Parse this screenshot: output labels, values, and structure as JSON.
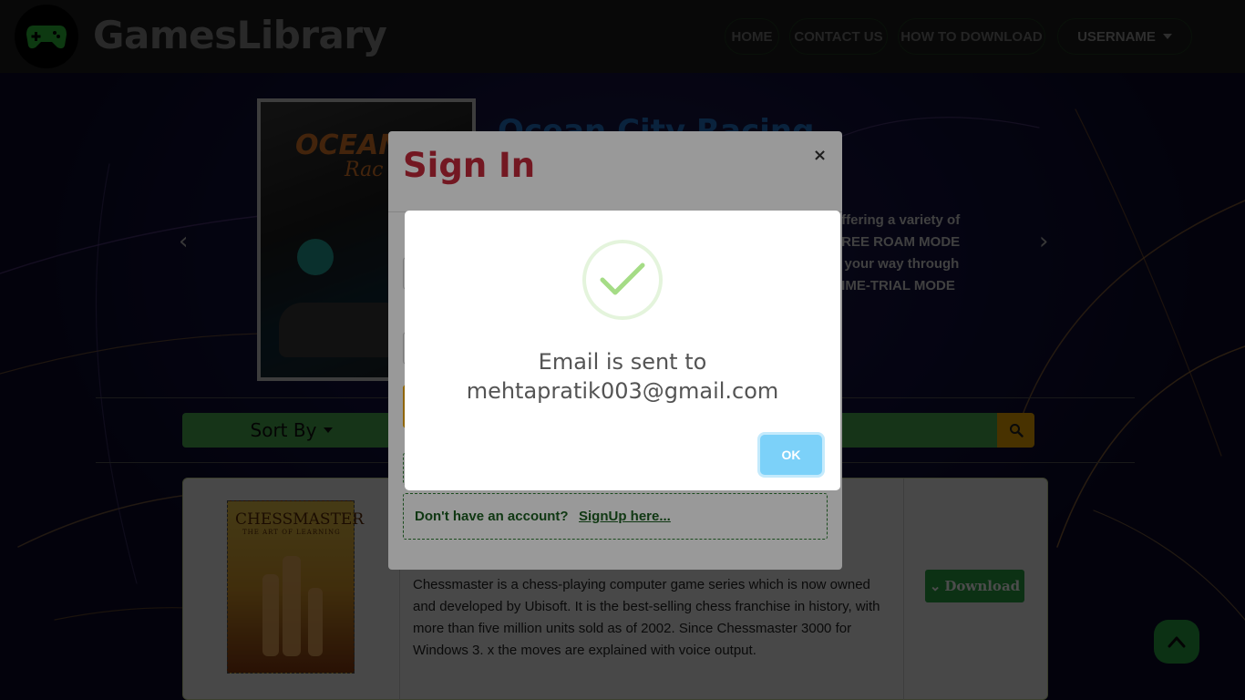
{
  "nav": {
    "brand": "GamesLibrary",
    "items": [
      "HOME",
      "CONTACT US",
      "HOW TO DOWNLOAD"
    ],
    "user": "USERNAME"
  },
  "carousel": {
    "game_title": "Ocean City Racing",
    "cover_title": "OCEAN",
    "cover_sub": "Rac",
    "desc_lines": [
      "offering a variety of",
      "FREE ROAM MODE",
      "e your way through",
      "TIME-TRIAL MODE"
    ]
  },
  "controls": {
    "sort_label": "Sort By"
  },
  "card": {
    "cover_title": "CHESSMASTER",
    "cover_sub": "THE ART OF LEARNING",
    "description": "Chessmaster is a chess-playing computer game series which is now owned and developed by Ubisoft. It is the best-selling chess franchise in history, with more than five million units sold as of 2002. Since Chessmaster 3000 for Windows 3. x the moves are explained with voice output.",
    "download_label": "Download"
  },
  "signin_modal": {
    "title": "Sign In",
    "close": "×",
    "signup_question": "Don't have an account?",
    "signup_link": "SignUp here..."
  },
  "alert": {
    "line1": "Email is sent to",
    "line2": "mehtapratik003@gmail.com",
    "ok_label": "OK",
    "icon": "check-icon"
  },
  "colors": {
    "accent_green": "#28a745",
    "modal_title": "#c0283a",
    "ok_button": "#7cd1f9",
    "search_button": "#f0a800"
  }
}
